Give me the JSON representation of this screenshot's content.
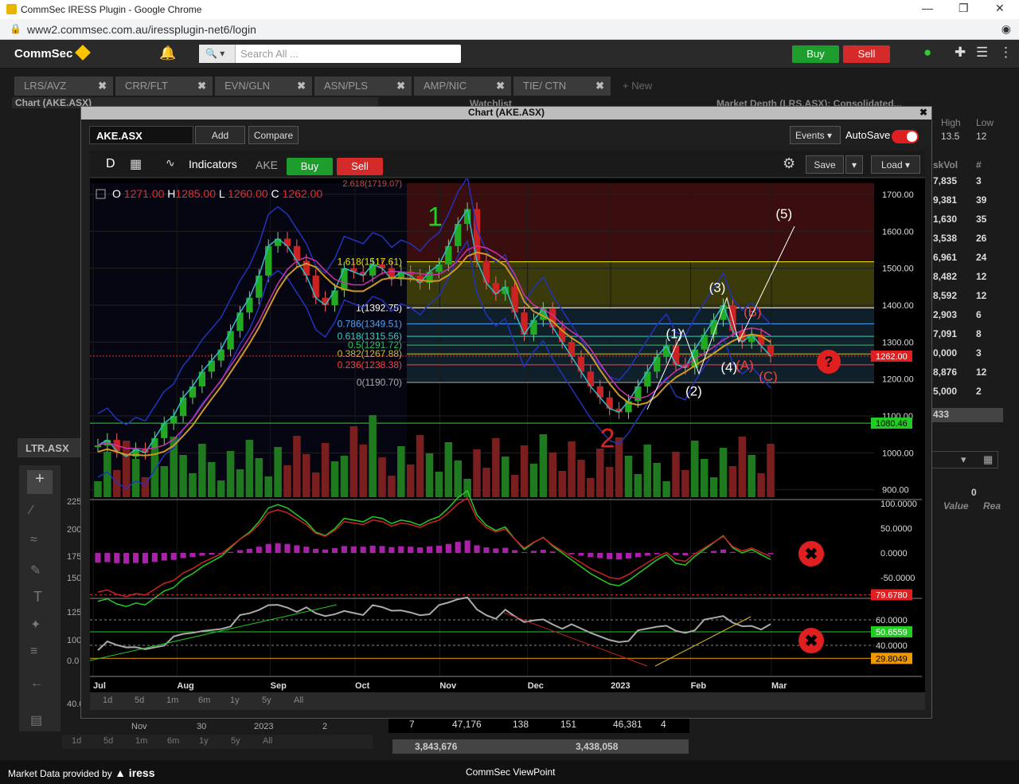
{
  "browser": {
    "window_title": "CommSec IRESS Plugin - Google Chrome",
    "url": "www2.commsec.com.au/iressplugin-net6/login"
  },
  "topbar": {
    "logo": "CommSec",
    "search_placeholder": "Search All ...",
    "buy_label": "Buy",
    "sell_label": "Sell"
  },
  "tabs": [
    {
      "label": "LRS/AVZ"
    },
    {
      "label": "CRR/FLT"
    },
    {
      "label": "EVN/GLN"
    },
    {
      "label": "ASN/PLS"
    },
    {
      "label": "AMP/NIC"
    },
    {
      "label": "TIE/ CTN"
    },
    {
      "label": "+ New"
    }
  ],
  "background": {
    "chart_title": "Chart (AKE.ASX)",
    "watchlist": "Watchlist",
    "market_depth": "Market Depth (LRS.ASX): Consolidated...",
    "high_label": "High",
    "low_label": "Low",
    "high_val": "13.5",
    "low_val": "12",
    "skvol_label": "skVol",
    "hash_label": "#",
    "depth_rows": [
      {
        "vol": "7,835",
        "n": "3"
      },
      {
        "vol": "9,381",
        "n": "39"
      },
      {
        "vol": "1,630",
        "n": "35"
      },
      {
        "vol": "3,538",
        "n": "26"
      },
      {
        "vol": "6,961",
        "n": "24"
      },
      {
        "vol": "8,482",
        "n": "12"
      },
      {
        "vol": "8,592",
        "n": "12"
      },
      {
        "vol": "2,903",
        "n": "6"
      },
      {
        "vol": "7,091",
        "n": "8"
      },
      {
        "vol": "0,000",
        "n": "3"
      },
      {
        "vol": "8,876",
        "n": "12"
      },
      {
        "vol": "5,000",
        "n": "2"
      }
    ],
    "depth_last": "433",
    "zero": "0",
    "value_label": "Value",
    "rea_label": "Rea",
    "ltr": "LTR.ASX",
    "bottom_row": [
      "7",
      "47,176",
      "138",
      "151",
      "46,381",
      "4"
    ],
    "totals": [
      "3,843,676",
      "3,438,058"
    ],
    "left_axis": [
      "225",
      "200",
      "175",
      "150",
      "125",
      "100",
      "0.0",
      "40.0"
    ],
    "left_dates": [
      "Nov",
      "30",
      "2023",
      "2"
    ],
    "left_ranges": [
      "1d",
      "5d",
      "1m",
      "6m",
      "1y",
      "5y",
      "All"
    ]
  },
  "modal": {
    "title": "Chart (AKE.ASX)",
    "symbol": "AKE.ASX",
    "add_label": "Add",
    "compare_label": "Compare",
    "events_label": "Events",
    "autosave_label": "AutoSave",
    "period": "D",
    "indicators_label": "Indicators",
    "code": "AKE",
    "buy_label": "Buy",
    "sell_label": "Sell",
    "save_label": "Save",
    "load_label": "Load",
    "ranges": [
      "1d",
      "5d",
      "1m",
      "6m",
      "1y",
      "5y",
      "All"
    ]
  },
  "chart_data": {
    "type": "candlestick",
    "ohlc_header": {
      "O": "1271.00",
      "H": "1285.00",
      "L": "1260.00",
      "C": "1262.00"
    },
    "price_axis": [
      "1700.00",
      "1600.00",
      "1500.00",
      "1400.00",
      "1300.00",
      "1200.00",
      "1100.00",
      "1000.00",
      "900.00"
    ],
    "price_range": [
      880,
      1730
    ],
    "last_price": "1262.00",
    "support_level": "1080.46",
    "x_labels": [
      "Jul",
      "Aug",
      "Sep",
      "Oct",
      "Nov",
      "Dec",
      "2023",
      "Feb",
      "Mar"
    ],
    "fib_levels": [
      {
        "label": "1.618(1517.61)",
        "value": 1517.61,
        "color": "#e6e600"
      },
      {
        "label": "1(1392.75)",
        "value": 1392.75,
        "color": "#ffffff"
      },
      {
        "label": "0.786(1349.51)",
        "value": 1349.51,
        "color": "#4aa3ff"
      },
      {
        "label": "0.618(1315.56)",
        "value": 1315.56,
        "color": "#35d0c0"
      },
      {
        "label": "0.5(1291.72)",
        "value": 1291.72,
        "color": "#30c060"
      },
      {
        "label": "0.382(1267.88)",
        "value": 1267.88,
        "color": "#c0c040"
      },
      {
        "label": "0.236(1238.38)",
        "value": 1238.38,
        "color": "#ff4040"
      },
      {
        "label": "0(1190.70)",
        "value": 1190.7,
        "color": "#aaaaaa"
      }
    ],
    "fib_top_label": "2.618(1719.07)",
    "wave_labels": [
      {
        "t": "1",
        "x": 0.44,
        "p": 1615,
        "c": "#22cc22",
        "s": 34
      },
      {
        "t": "2",
        "x": 0.66,
        "p": 1015,
        "c": "#dd2222",
        "s": 34
      },
      {
        "t": "(1)",
        "x": 0.745,
        "p": 1310,
        "c": "#ffffff",
        "s": 17
      },
      {
        "t": "(2)",
        "x": 0.77,
        "p": 1155,
        "c": "#ffffff",
        "s": 17
      },
      {
        "t": "(3)",
        "x": 0.8,
        "p": 1435,
        "c": "#ffffff",
        "s": 17
      },
      {
        "t": "(4)",
        "x": 0.815,
        "p": 1220,
        "c": "#ffffff",
        "s": 17
      },
      {
        "t": "(5)",
        "x": 0.885,
        "p": 1635,
        "c": "#ffffff",
        "s": 17
      },
      {
        "t": "(B)",
        "x": 0.845,
        "p": 1370,
        "c": "#ee4444",
        "s": 17
      },
      {
        "t": "(A)",
        "x": 0.835,
        "p": 1225,
        "c": "#ee4444",
        "s": 17
      },
      {
        "t": "(C)",
        "x": 0.865,
        "p": 1195,
        "c": "#ee4444",
        "s": 17
      }
    ],
    "macd_axis": [
      "100.0000",
      "50.0000",
      "0.0000",
      "-50.0000"
    ],
    "rsi_axis": [
      "79.6780",
      "60.0000",
      "50.6559",
      "40.0000",
      "29.8049"
    ],
    "close_series": [
      1020,
      1035,
      1005,
      990,
      1010,
      1000,
      1040,
      1080,
      1100,
      1150,
      1180,
      1220,
      1250,
      1280,
      1330,
      1380,
      1420,
      1480,
      1560,
      1580,
      1560,
      1520,
      1480,
      1420,
      1400,
      1440,
      1500,
      1490,
      1480,
      1510,
      1500,
      1470,
      1490,
      1480,
      1460,
      1490,
      1510,
      1560,
      1620,
      1660,
      1520,
      1460,
      1430,
      1450,
      1380,
      1320,
      1360,
      1390,
      1340,
      1300,
      1260,
      1220,
      1180,
      1150,
      1120,
      1110,
      1140,
      1180,
      1220,
      1260,
      1290,
      1240,
      1230,
      1280,
      1320,
      1360,
      1400,
      1330,
      1300,
      1320,
      1290,
      1262
    ]
  }
}
